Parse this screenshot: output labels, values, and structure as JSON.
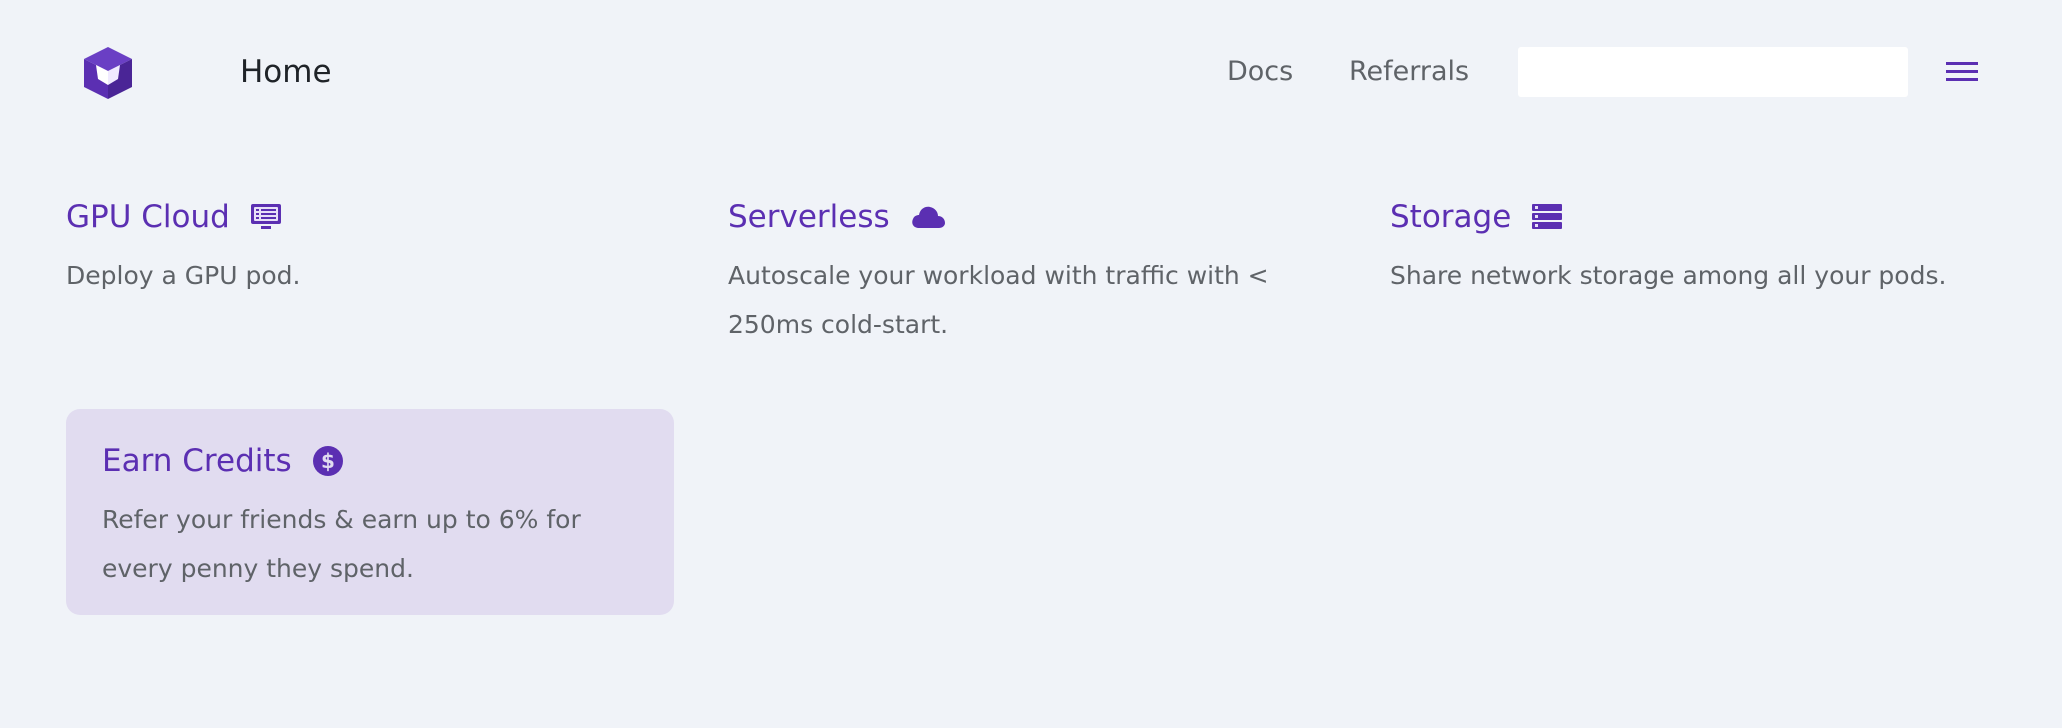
{
  "header": {
    "logo_icon": "cube-icon",
    "title": "Home",
    "nav": {
      "docs_label": "Docs",
      "referrals_label": "Referrals"
    },
    "search": {
      "value": "",
      "placeholder": ""
    },
    "menu_icon": "hamburger-menu-icon"
  },
  "cards": [
    {
      "title": "GPU Cloud",
      "icon": "monitor-icon",
      "description": "Deploy a GPU pod."
    },
    {
      "title": "Serverless",
      "icon": "cloud-icon",
      "description": "Autoscale your workload with traffic with < 250ms cold-start."
    },
    {
      "title": "Storage",
      "icon": "server-stack-icon",
      "description": "Share network storage among all your pods."
    },
    {
      "title": "Earn Credits",
      "icon": "dollar-coin-icon",
      "description": "Refer your friends & earn up to 6% for every penny they spend."
    }
  ],
  "colors": {
    "background": "#f0f3f8",
    "accent": "#5b2fb2",
    "highlight_card": "#e1dcf0",
    "muted_text": "#5f6368"
  }
}
